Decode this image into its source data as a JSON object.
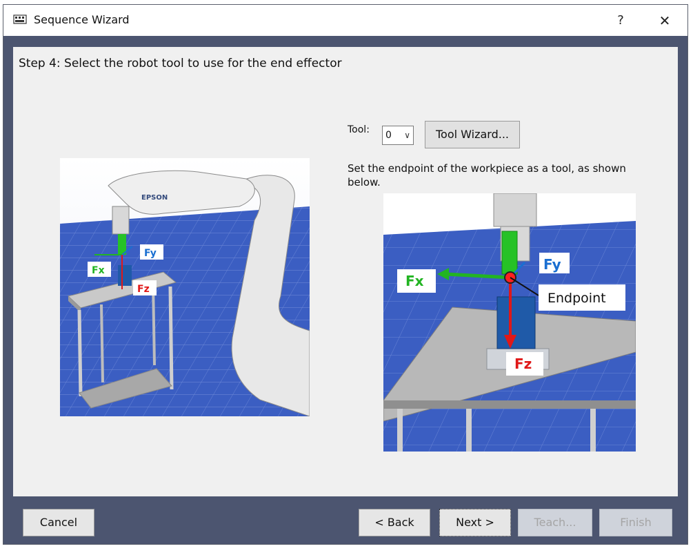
{
  "window": {
    "title": "Sequence Wizard",
    "help_label": "?",
    "close_label": "✕"
  },
  "step": {
    "text": "Step 4: Select the robot tool to use for the end effector"
  },
  "tool": {
    "label": "Tool:",
    "selected": "0",
    "wizard_label": "Tool Wizard...",
    "description": "Set the endpoint of the workpiece as a tool, as shown below."
  },
  "left_image": {
    "brand": "EPSON",
    "fx": "Fx",
    "fy": "Fy",
    "fz": "Fz"
  },
  "right_image": {
    "fx": "Fx",
    "fy": "Fy",
    "fz": "Fz",
    "endpoint": "Endpoint"
  },
  "footer": {
    "cancel": "Cancel",
    "back": "< Back",
    "next": "Next >",
    "teach": "Teach...",
    "finish": "Finish"
  },
  "colors": {
    "frame": "#4c5570",
    "panel": "#f0f0f0",
    "floor": "#3b5ec2",
    "fx": "#22b422",
    "fy": "#1a6fd1",
    "fz": "#e01818"
  }
}
